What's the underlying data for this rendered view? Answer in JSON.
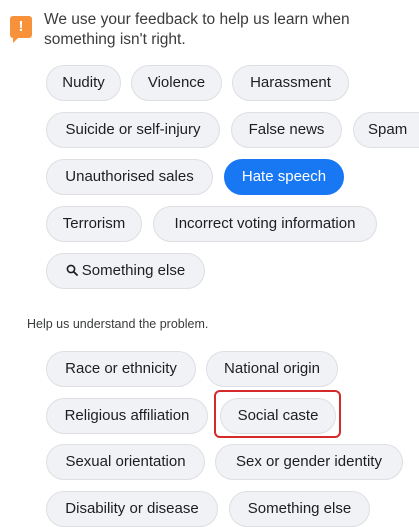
{
  "notice": {
    "text": "We use your feedback to help us learn when something isn't right."
  },
  "categories": [
    {
      "label": "Nudity"
    },
    {
      "label": "Violence"
    },
    {
      "label": "Harassment"
    },
    {
      "label": "Suicide or self-injury"
    },
    {
      "label": "False news"
    },
    {
      "label": "Spam"
    },
    {
      "label": "Unauthorised sales"
    },
    {
      "label": "Hate speech",
      "selected": true
    },
    {
      "label": "Terrorism"
    },
    {
      "label": "Incorrect voting information"
    },
    {
      "label": "Something else"
    }
  ],
  "problem_heading": "Help us understand the problem.",
  "problems": [
    {
      "label": "Race or ethnicity"
    },
    {
      "label": "National origin"
    },
    {
      "label": "Religious affiliation"
    },
    {
      "label": "Social caste",
      "highlighted": true
    },
    {
      "label": "Sexual orientation"
    },
    {
      "label": "Sex or gender identity"
    },
    {
      "label": "Disability or disease"
    },
    {
      "label": "Something else"
    }
  ],
  "colors": {
    "accent": "#1877f2",
    "notice_badge": "#f7923a",
    "highlight_border": "#d42a2a"
  },
  "icons": [
    "exclamation-icon",
    "search-icon"
  ]
}
